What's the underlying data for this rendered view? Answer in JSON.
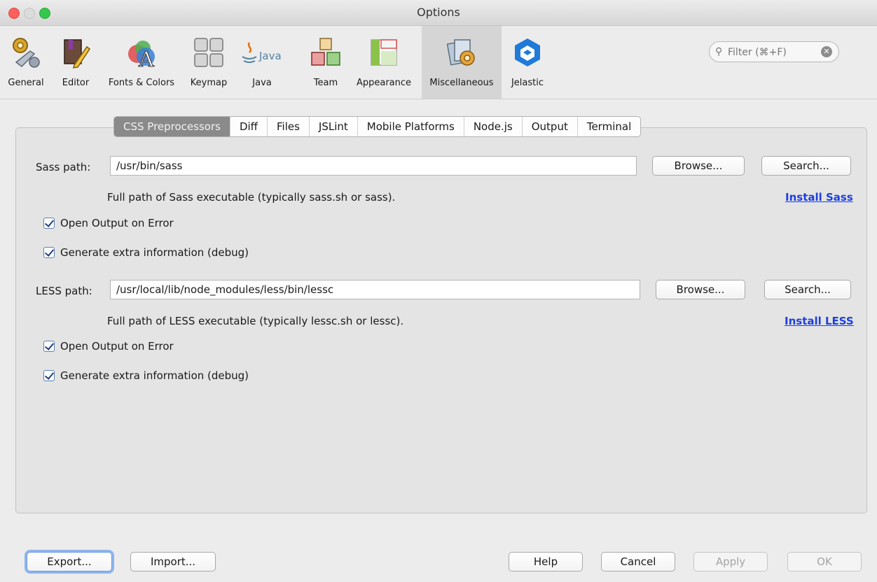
{
  "window": {
    "title": "Options"
  },
  "toolbar": {
    "items": [
      {
        "label": "General",
        "icon": "gear-wrench-icon"
      },
      {
        "label": "Editor",
        "icon": "book-pencil-icon"
      },
      {
        "label": "Fonts & Colors",
        "icon": "fonts-colors-icon"
      },
      {
        "label": "Keymap",
        "icon": "keyboard-icon"
      },
      {
        "label": "Java",
        "icon": "java-icon",
        "icon_text": "Java"
      },
      {
        "label": "Team",
        "icon": "team-cubes-icon"
      },
      {
        "label": "Appearance",
        "icon": "appearance-icon"
      },
      {
        "label": "Miscellaneous",
        "icon": "miscellaneous-icon",
        "selected": true
      },
      {
        "label": "Jelastic",
        "icon": "jelastic-icon"
      }
    ],
    "filter": {
      "placeholder": "Filter (⌘+F)"
    }
  },
  "tabs": [
    {
      "label": "CSS Preprocessors",
      "active": true
    },
    {
      "label": "Diff"
    },
    {
      "label": "Files"
    },
    {
      "label": "JSLint"
    },
    {
      "label": "Mobile Platforms"
    },
    {
      "label": "Node.js"
    },
    {
      "label": "Output"
    },
    {
      "label": "Terminal"
    }
  ],
  "sass": {
    "path_label": "Sass path:",
    "path_value": "/usr/bin/sass",
    "browse_label": "Browse...",
    "search_label": "Search...",
    "hint": "Full path of Sass executable (typically sass.sh or sass).",
    "install_link": "Install Sass",
    "open_output_label": "Open Output on Error",
    "open_output_checked": true,
    "debug_label": "Generate extra information (debug)",
    "debug_checked": true
  },
  "less": {
    "path_label": "LESS path:",
    "path_value": "/usr/local/lib/node_modules/less/bin/lessc",
    "browse_label": "Browse...",
    "search_label": "Search...",
    "hint": "Full path of LESS executable (typically lessc.sh or lessc).",
    "install_link": "Install LESS",
    "open_output_label": "Open Output on Error",
    "open_output_checked": true,
    "debug_label": "Generate extra information (debug)",
    "debug_checked": true
  },
  "footer": {
    "export_label": "Export...",
    "import_label": "Import...",
    "help_label": "Help",
    "cancel_label": "Cancel",
    "apply_label": "Apply",
    "ok_label": "OK"
  }
}
